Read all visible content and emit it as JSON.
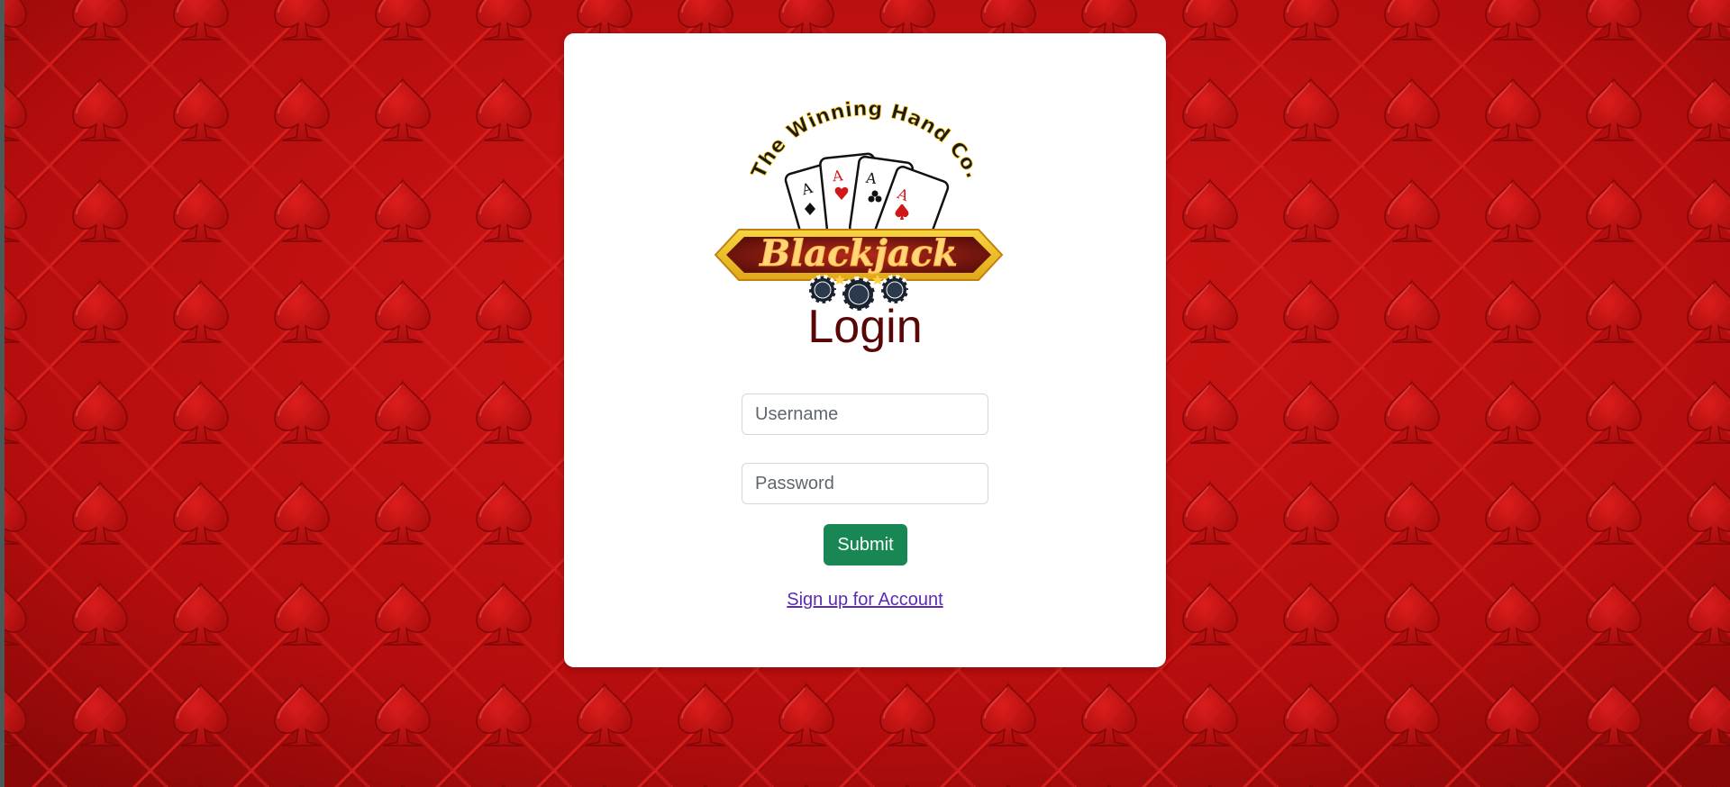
{
  "logo": {
    "arc_text": "The Winning Hand Co.",
    "banner_text": "Blackjack"
  },
  "login": {
    "title": "Login",
    "username_placeholder": "Username",
    "password_placeholder": "Password",
    "submit_label": "Submit",
    "signup_link": "Sign up for Account"
  },
  "colors": {
    "background": "#b00d0d",
    "title": "#5a0606",
    "submit": "#198754",
    "link": "#5b2bb3"
  }
}
